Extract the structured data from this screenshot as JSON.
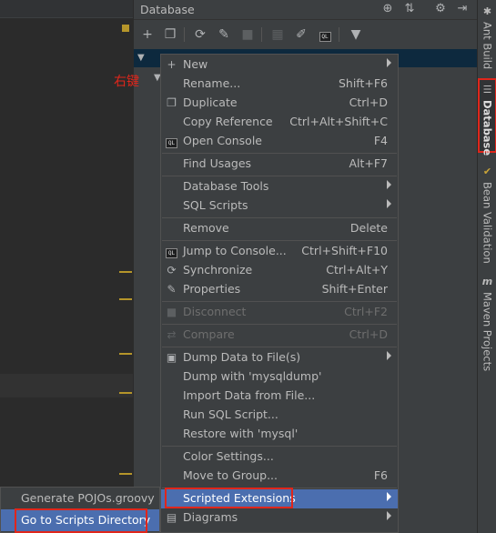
{
  "window": {
    "title": "Database"
  },
  "annotation": {
    "right_click_note": "右键"
  },
  "right_stripe": {
    "items": [
      {
        "label": "Ant Build",
        "icon": "ant-icon"
      },
      {
        "label": "Database",
        "icon": "database-icon",
        "active": true
      },
      {
        "label": "Bean Validation",
        "icon": "bean-validation-icon"
      },
      {
        "label": "Maven Projects",
        "icon": "maven-icon"
      }
    ]
  },
  "context_menu": {
    "items": [
      {
        "label": "New",
        "shortcut": "",
        "icon": "plus-icon",
        "submenu": true
      },
      {
        "label": "Rename...",
        "shortcut": "Shift+F6",
        "icon": ""
      },
      {
        "label": "Duplicate",
        "shortcut": "Ctrl+D",
        "icon": "duplicate-icon"
      },
      {
        "label": "Copy Reference",
        "shortcut": "Ctrl+Alt+Shift+C",
        "icon": ""
      },
      {
        "label": "Open Console",
        "shortcut": "F4",
        "icon": "console-icon"
      },
      {
        "label": "Find Usages",
        "shortcut": "Alt+F7",
        "icon": ""
      },
      {
        "label": "Database Tools",
        "shortcut": "",
        "icon": "",
        "submenu": true
      },
      {
        "label": "SQL Scripts",
        "shortcut": "",
        "icon": "",
        "submenu": true
      },
      {
        "label": "Remove",
        "shortcut": "Delete",
        "icon": ""
      },
      {
        "label": "Jump to Console...",
        "shortcut": "Ctrl+Shift+F10",
        "icon": "console-icon"
      },
      {
        "label": "Synchronize",
        "shortcut": "Ctrl+Alt+Y",
        "icon": "refresh-icon"
      },
      {
        "label": "Properties",
        "shortcut": "Shift+Enter",
        "icon": "properties-icon"
      },
      {
        "label": "Disconnect",
        "shortcut": "Ctrl+F2",
        "icon": "stop-icon",
        "disabled": true
      },
      {
        "label": "Compare",
        "shortcut": "Ctrl+D",
        "icon": "compare-icon",
        "disabled": true
      },
      {
        "label": "Dump Data to File(s)",
        "shortcut": "",
        "icon": "save-icon",
        "submenu": true
      },
      {
        "label": "Dump with 'mysqldump'",
        "shortcut": "",
        "icon": ""
      },
      {
        "label": "Import Data from File...",
        "shortcut": "",
        "icon": ""
      },
      {
        "label": "Run SQL Script...",
        "shortcut": "",
        "icon": ""
      },
      {
        "label": "Restore with 'mysql'",
        "shortcut": "",
        "icon": ""
      },
      {
        "label": "Color Settings...",
        "shortcut": "",
        "icon": ""
      },
      {
        "label": "Move to Group...",
        "shortcut": "F6",
        "icon": ""
      },
      {
        "label": "Scripted Extensions",
        "shortcut": "",
        "icon": "",
        "submenu": true,
        "selected": true
      },
      {
        "label": "Diagrams",
        "shortcut": "",
        "icon": "diagram-icon",
        "submenu": true
      }
    ]
  },
  "submenu": {
    "items": [
      {
        "label": "Generate POJOs.groovy"
      },
      {
        "label": "Go to Scripts Directory",
        "selected": true
      }
    ]
  },
  "colors": {
    "selection": "#4b6eaf",
    "highlight_box": "#e0261b",
    "background": "#3c3f41"
  }
}
